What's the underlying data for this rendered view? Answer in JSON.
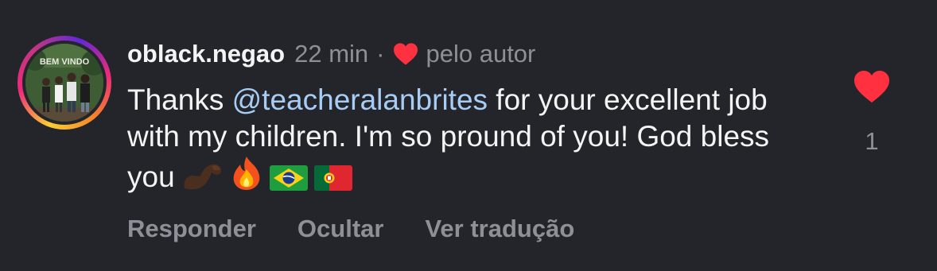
{
  "comment": {
    "username": "oblack.negao",
    "time": "22 min",
    "separator": "·",
    "author_liked_label": "pelo autor",
    "text_before_mention": "Thanks ",
    "mention": "@teacheralanbrites",
    "text_after_mention": "  for your excellent job with my children. I'm so pround of you! God bless you",
    "emojis": [
      "flexed-biceps-dark",
      "fire",
      "flag-brazil",
      "flag-portugal"
    ],
    "avatar_banner_text": "BEM VINDO"
  },
  "actions": {
    "reply": "Responder",
    "hide": "Ocultar",
    "translate": "Ver tradução"
  },
  "like": {
    "count": "1",
    "liked": true
  },
  "colors": {
    "background": "#23252a",
    "text": "#f4f4f5",
    "muted": "#8e9097",
    "mention": "#a8cdf5",
    "heart": "#ff3040"
  }
}
